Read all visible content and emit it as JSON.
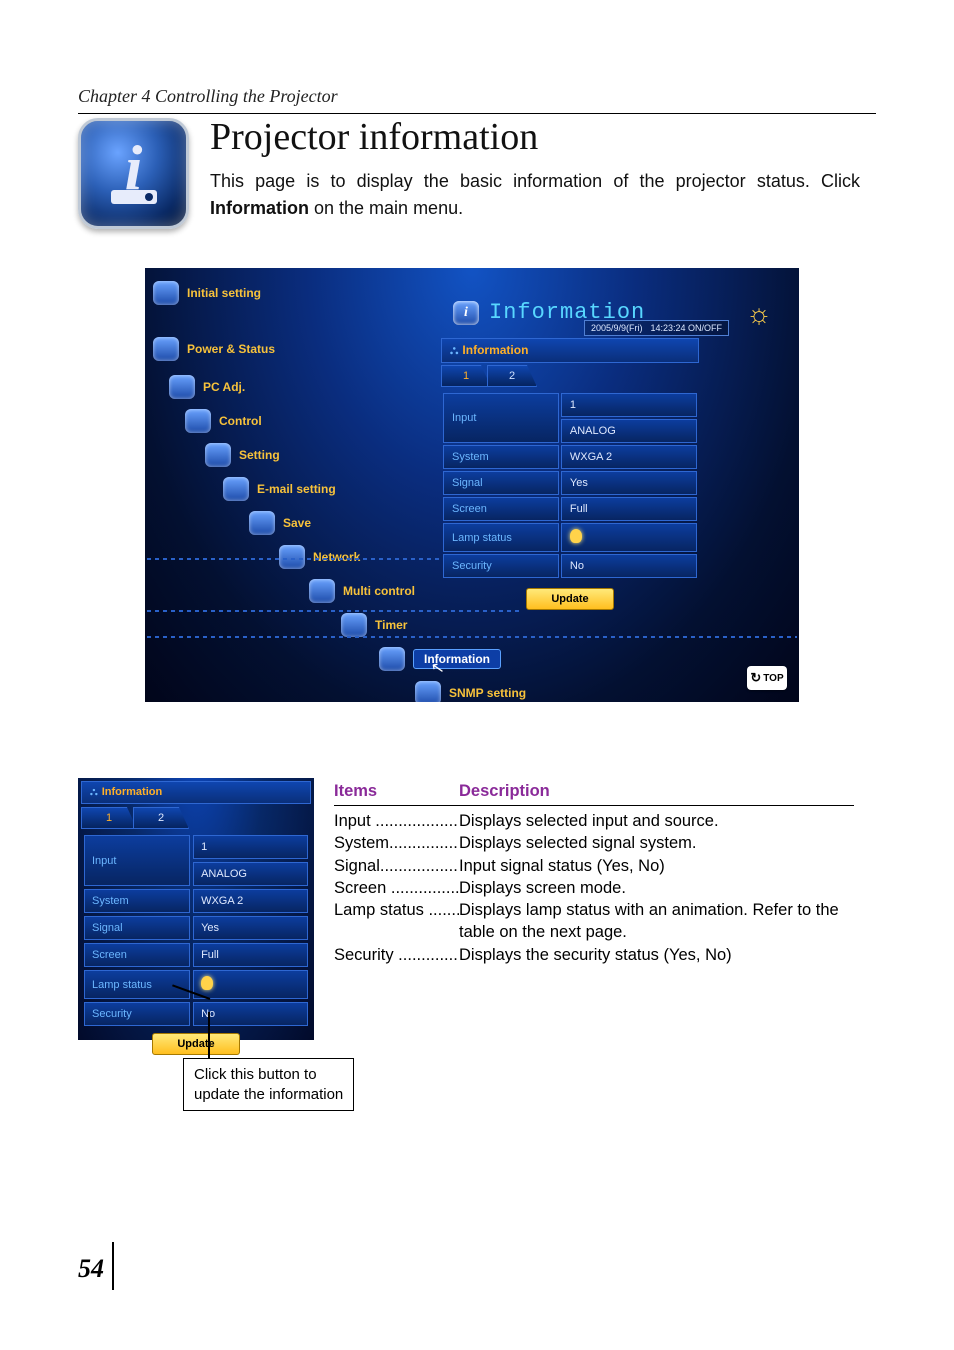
{
  "chapter_heading": "Chapter 4 Controlling the Projector",
  "section_title": "Projector information",
  "intro_before_bold": "This page is to display the basic information of the projector status. Click ",
  "intro_bold": "Information",
  "intro_after_bold": " on the main menu.",
  "screenshot": {
    "title": "Information",
    "date": "2005/9/9(Fri)",
    "time_mode": "14:23:24  ON/OFF",
    "menu_items": [
      "Initial setting",
      "Power & Status",
      "PC Adj.",
      "Control",
      "Setting",
      "E-mail setting",
      "Save",
      "Network",
      "Multi control",
      "Timer",
      "Information",
      "SNMP setting"
    ],
    "panel_header": "Information",
    "tabs": [
      "1",
      "2"
    ],
    "rows": [
      {
        "k": "Input",
        "v": "1"
      },
      {
        "k": "",
        "v": "ANALOG"
      },
      {
        "k": "System",
        "v": "WXGA 2"
      },
      {
        "k": "Signal",
        "v": "Yes"
      },
      {
        "k": "Screen",
        "v": "Full"
      },
      {
        "k": "Lamp status",
        "v": "__LAMP__"
      },
      {
        "k": "Security",
        "v": "No"
      }
    ],
    "update_label": "Update",
    "top_label": "TOP"
  },
  "callout_l1": "Click this button to",
  "callout_l2": "update the information",
  "table": {
    "col1": "Items",
    "col2": "Description",
    "rows": [
      {
        "k": "Input ..................",
        "v": "Displays selected input and source."
      },
      {
        "k": "System...............",
        "v": "Displays selected signal system."
      },
      {
        "k": "Signal.................",
        "v": "Input signal status (Yes, No)"
      },
      {
        "k": "Screen ...............",
        "v": "Displays screen mode."
      },
      {
        "k": "Lamp status ........",
        "v": "Displays lamp status with an animation. Refer to the table on the next page."
      },
      {
        "k": "Security .............",
        "v": "Displays the security status (Yes, No)"
      }
    ]
  },
  "page_number": "54"
}
